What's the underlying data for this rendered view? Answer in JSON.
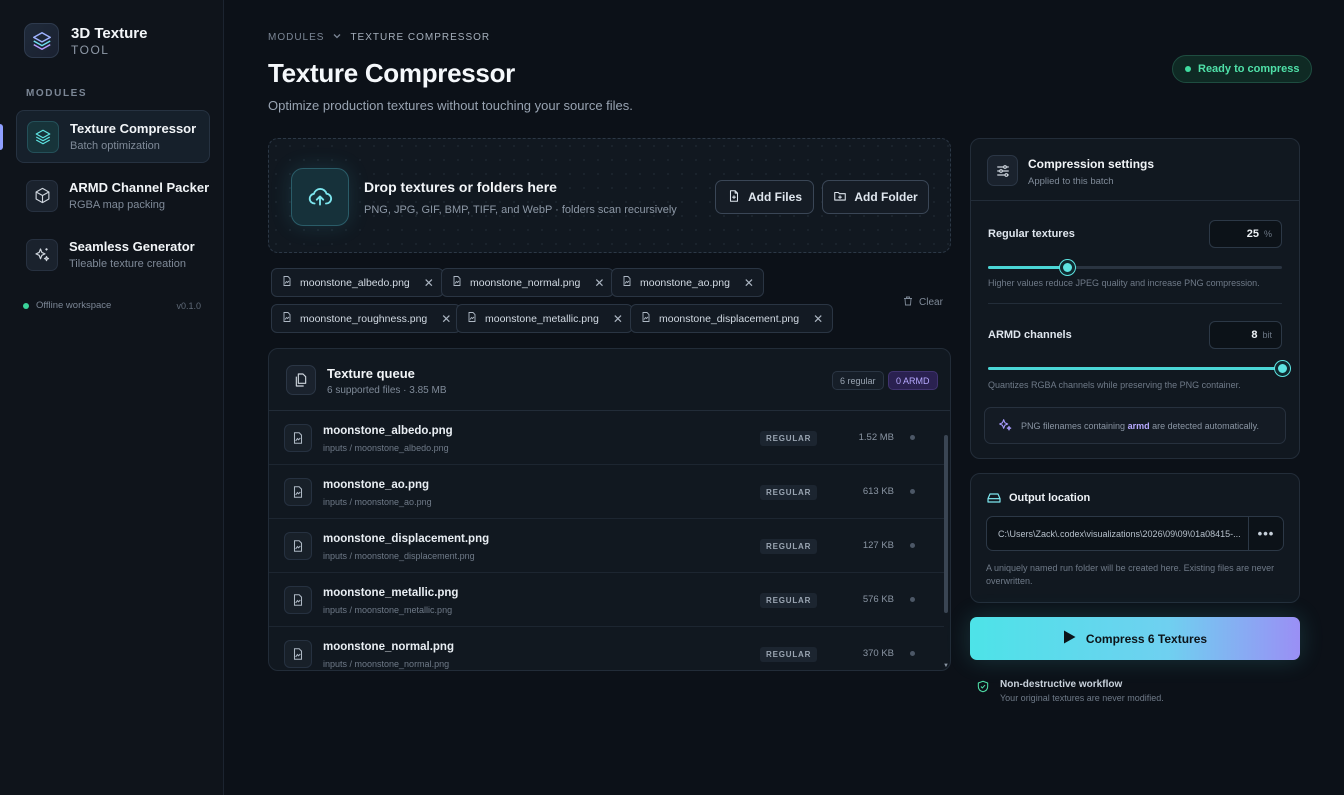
{
  "app": {
    "title": "3D Texture",
    "subtitle": "TOOL",
    "section_label": "MODULES"
  },
  "nav": [
    {
      "title": "Texture Compressor",
      "sub": "Batch optimization",
      "icon": "layers-icon"
    },
    {
      "title": "ARMD Channel Packer",
      "sub": "RGBA map packing",
      "icon": "cube-icon"
    },
    {
      "title": "Seamless Generator",
      "sub": "Tileable texture creation",
      "icon": "sparkles-icon"
    }
  ],
  "workspace": {
    "status": "Offline workspace",
    "version": "v0.1.0"
  },
  "breadcrumb": {
    "root": "MODULES",
    "current": "TEXTURE COMPRESSOR"
  },
  "header": {
    "title": "Texture Compressor",
    "subtitle": "Optimize production textures without touching your source files.",
    "status": "Ready to compress"
  },
  "dropzone": {
    "title": "Drop textures or folders here",
    "sub": "PNG, JPG, GIF, BMP, TIFF, and WebP · folders scan recursively",
    "add_files": "Add Files",
    "add_folder": "Add Folder"
  },
  "chips": [
    "moonstone_albedo.png",
    "moonstone_normal.png",
    "moonstone_ao.png",
    "moonstone_roughness.png",
    "moonstone_metallic.png",
    "moonstone_displacement.png"
  ],
  "clear_label": "Clear",
  "queue": {
    "title": "Texture queue",
    "sub": "6 supported files · 3.85 MB",
    "regular_badge": "6 regular",
    "armd_badge": "0 ARMD",
    "rows": [
      {
        "name": "moonstone_albedo.png",
        "path": "inputs / moonstone_albedo.png",
        "tag": "REGULAR",
        "size": "1.52 MB"
      },
      {
        "name": "moonstone_ao.png",
        "path": "inputs / moonstone_ao.png",
        "tag": "REGULAR",
        "size": "613 KB"
      },
      {
        "name": "moonstone_displacement.png",
        "path": "inputs / moonstone_displacement.png",
        "tag": "REGULAR",
        "size": "127 KB"
      },
      {
        "name": "moonstone_metallic.png",
        "path": "inputs / moonstone_metallic.png",
        "tag": "REGULAR",
        "size": "576 KB"
      },
      {
        "name": "moonstone_normal.png",
        "path": "inputs / moonstone_normal.png",
        "tag": "REGULAR",
        "size": "370 KB"
      }
    ]
  },
  "settings": {
    "title": "Compression settings",
    "sub": "Applied to this batch",
    "regular_label": "Regular textures",
    "regular_value": "25",
    "regular_unit": "%",
    "regular_fraction": 0.27,
    "regular_hint": "Higher values reduce JPEG quality and increase PNG compression.",
    "armd_label": "ARMD channels",
    "armd_value": "8",
    "armd_unit": "bit",
    "armd_fraction": 1.0,
    "armd_hint": "Quantizes RGBA channels while preserving the PNG container.",
    "note_before": "PNG filenames containing ",
    "note_keyword": "armd",
    "note_after": " are detected automatically."
  },
  "output": {
    "title": "Output location",
    "path": "C:\\Users\\Zack\\.codex\\visualizations\\2026\\09\\09\\01a08415-...",
    "hint": "A uniquely named run folder will be created here. Existing files are never overwritten."
  },
  "compress_button": "Compress 6 Textures",
  "footer_note": {
    "title": "Non-destructive workflow",
    "sub": "Your original textures are never modified."
  },
  "colors": {
    "accent": "#4de3e8",
    "accent_purple": "#9a8ff5",
    "ready": "#4fe0a8",
    "background": "#0c1118"
  }
}
